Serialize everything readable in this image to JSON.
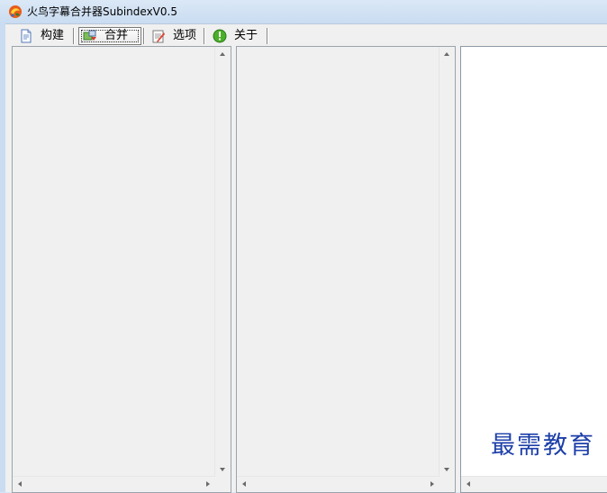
{
  "window": {
    "title": "火鸟字幕合并器SubindexV0.5",
    "icon": "app-logo-icon"
  },
  "toolbar": {
    "items": [
      {
        "label": "构建",
        "icon": "document-build-icon",
        "active": false
      },
      {
        "label": "合并",
        "icon": "merge-icon",
        "active": true
      },
      {
        "label": "选项",
        "icon": "options-icon",
        "active": false
      },
      {
        "label": "关于",
        "icon": "info-icon",
        "active": false
      }
    ]
  },
  "panels": [
    {
      "name": "left-list",
      "background": "#f0f0f0"
    },
    {
      "name": "middle-list",
      "background": "#f0f0f0"
    },
    {
      "name": "right-preview",
      "background": "#ffffff"
    }
  ],
  "watermark": {
    "text": "最需教育",
    "color": "#1d3fa8"
  }
}
